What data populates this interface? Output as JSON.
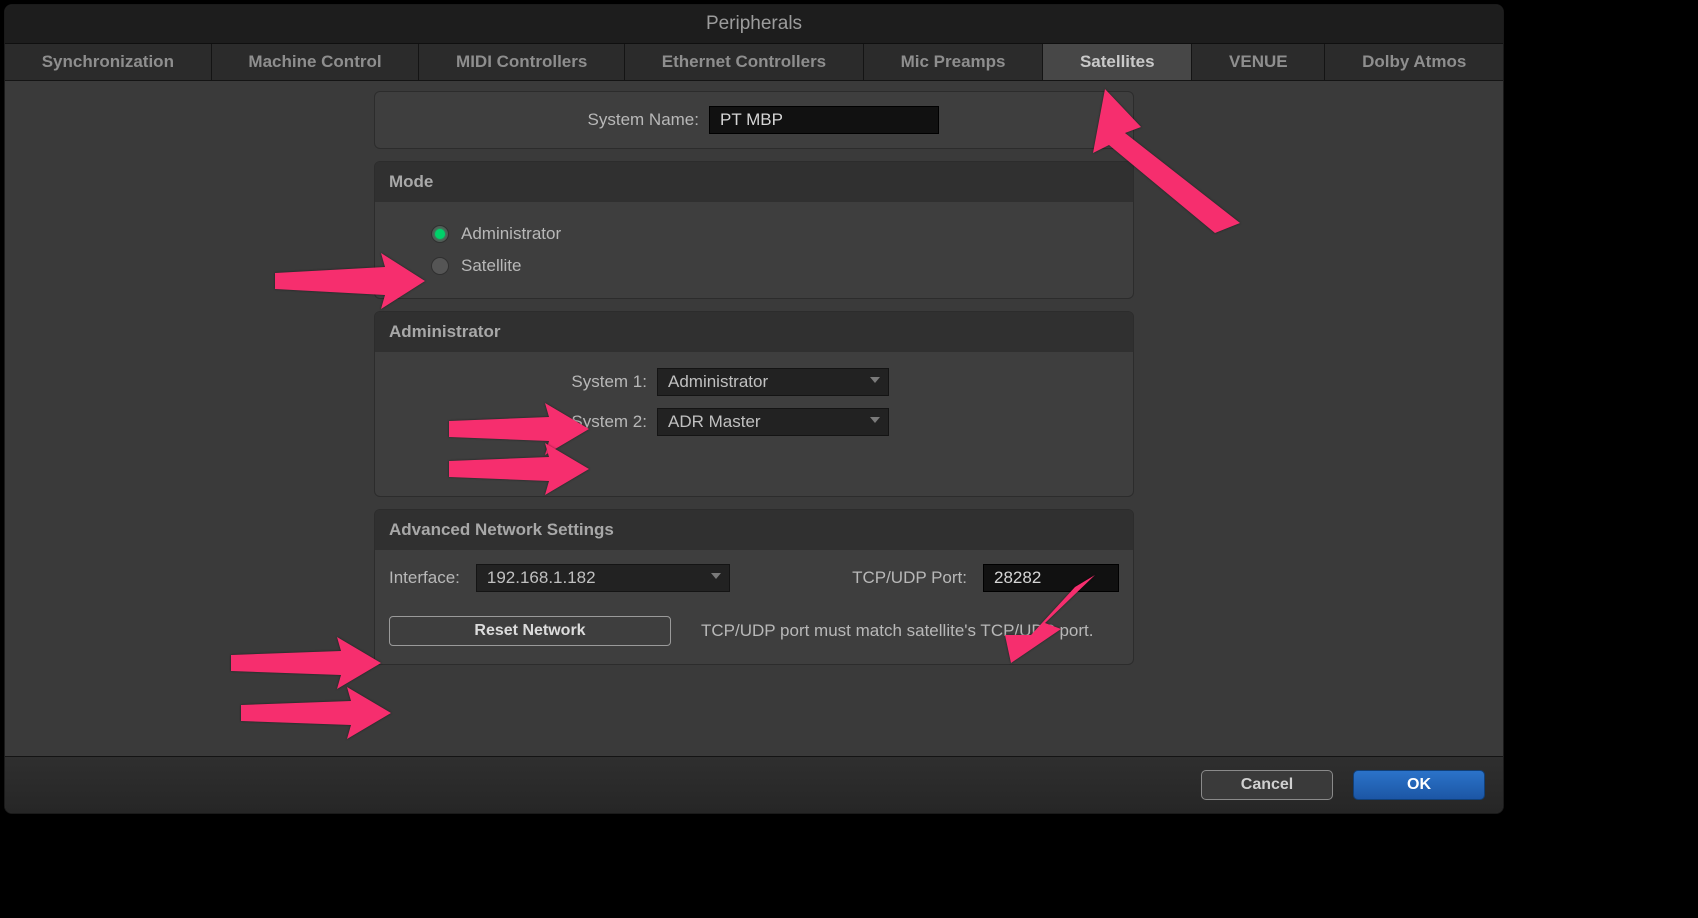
{
  "window_title": "Peripherals",
  "tabs": [
    "Synchronization",
    "Machine Control",
    "MIDI Controllers",
    "Ethernet Controllers",
    "Mic Preamps",
    "Satellites",
    "VENUE",
    "Dolby Atmos"
  ],
  "active_tab_index": 5,
  "system_name_label": "System Name:",
  "system_name_value": "PT MBP",
  "mode": {
    "header": "Mode",
    "options": [
      "Administrator",
      "Satellite"
    ],
    "selected_index": 0
  },
  "administrator": {
    "header": "Administrator",
    "rows": [
      {
        "label": "System 1:",
        "value": "Administrator"
      },
      {
        "label": "System 2:",
        "value": "ADR Master"
      }
    ]
  },
  "network": {
    "header": "Advanced Network Settings",
    "interface_label": "Interface:",
    "interface_value": "192.168.1.182",
    "port_label": "TCP/UDP Port:",
    "port_value": "28282",
    "reset_label": "Reset Network",
    "hint": "TCP/UDP port must match satellite's TCP/UDP port."
  },
  "footer": {
    "cancel": "Cancel",
    "ok": "OK"
  }
}
